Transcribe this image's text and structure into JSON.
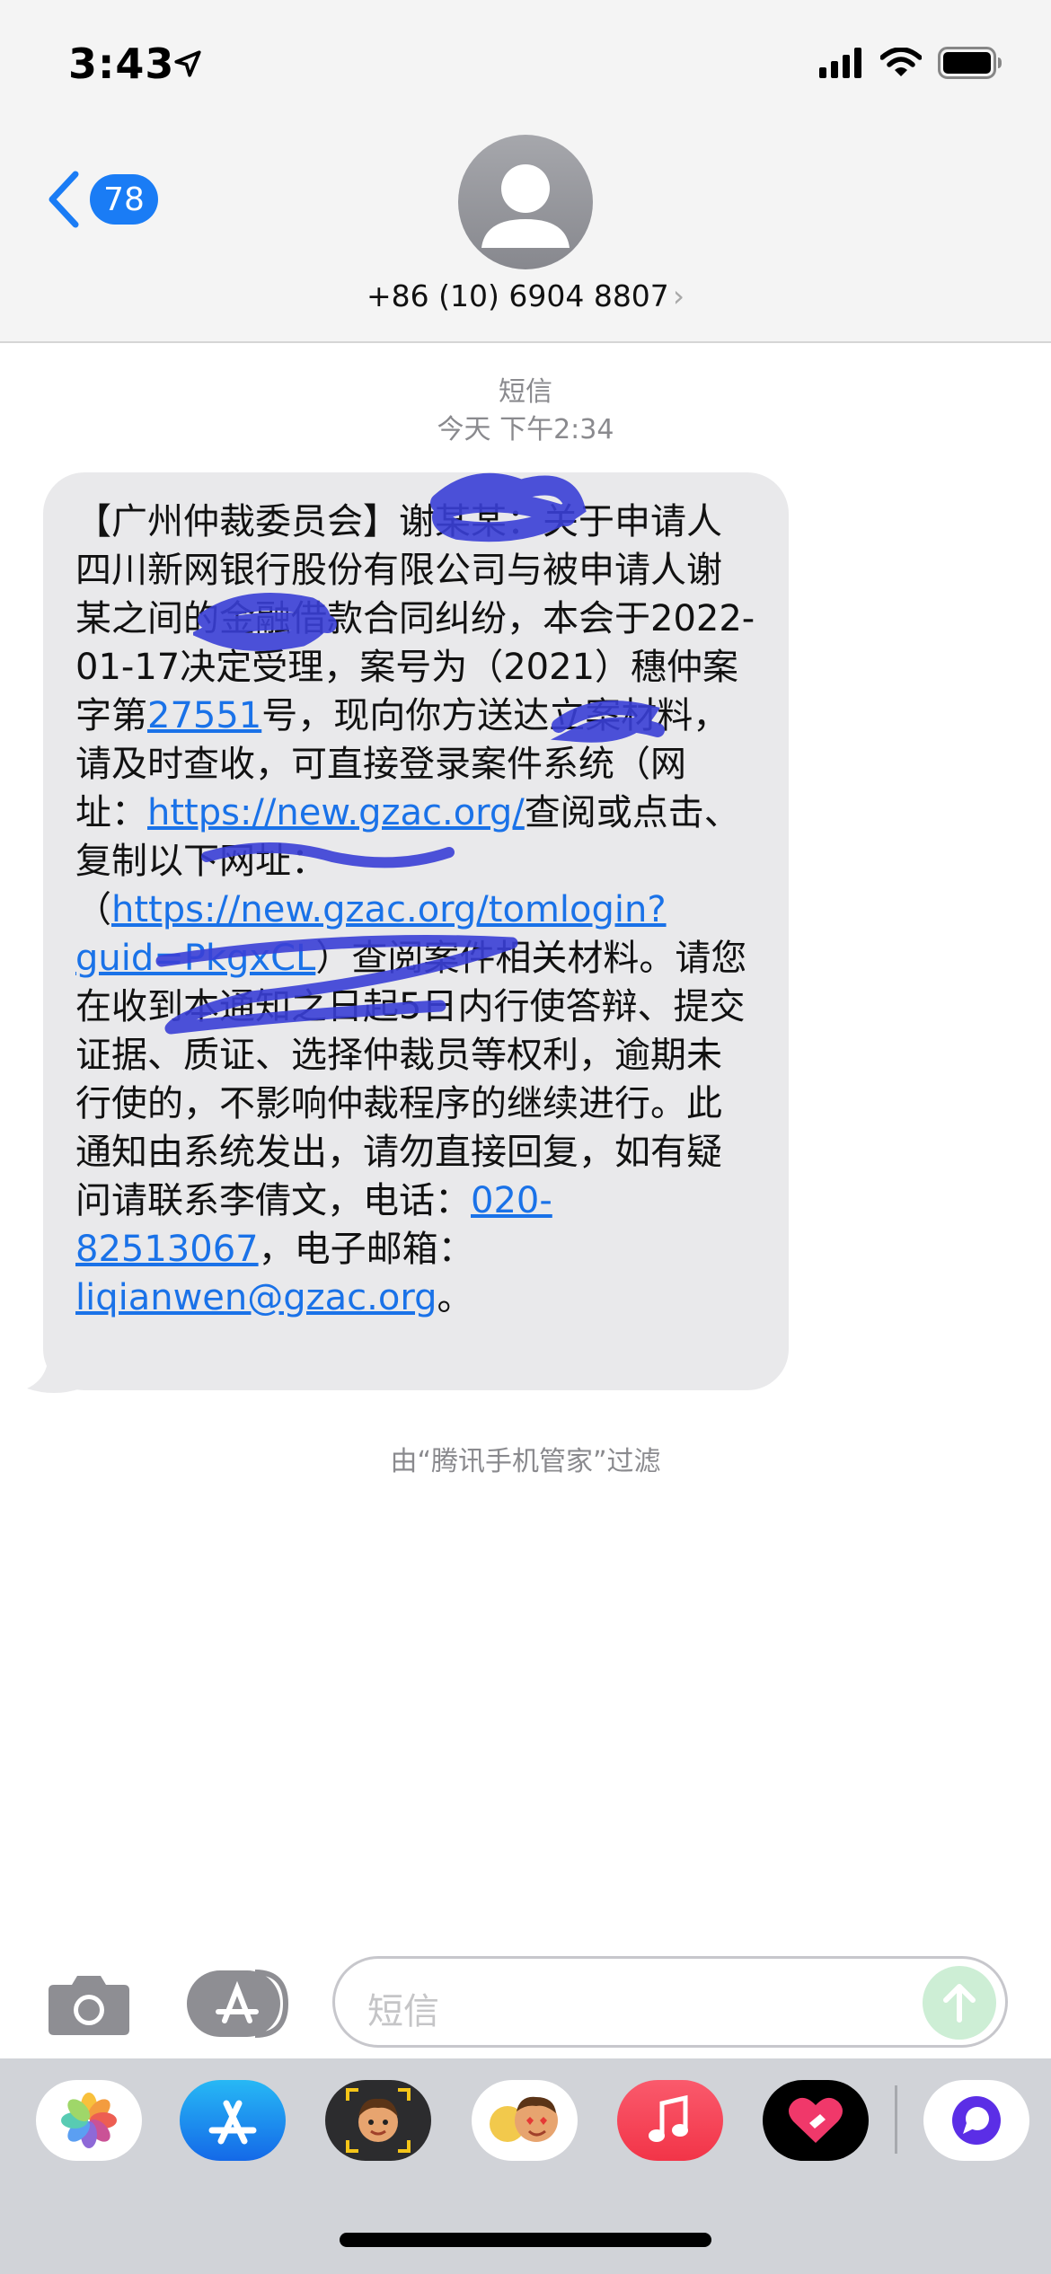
{
  "status_bar": {
    "time": "3:43"
  },
  "header": {
    "back_badge": "78",
    "contact": "+86 (10) 6904 8807",
    "contact_chevron": "›"
  },
  "message": {
    "service": "短信",
    "timestamp": "今天 下午2:34",
    "t1": "【广州仲裁委员会】",
    "t2": "：关于申请人四川新网银行股份有限公司与被申请人",
    "t3": "之间的金融借款合同纠纷，本会于2022-01-17决定受理，案号为（2021）穗仲案字第",
    "link_case": "27551",
    "t4": "号，现向你方送达立案材料，请及时查收，可直接登录案件系统（网址：",
    "link_site": "https://new.gzac.org/",
    "t5": "查阅或点击、复制以下网址：（",
    "link_login": "https://new.gzac.org/tomlogin?guid=PkgxCL",
    "t6": "）查阅案件相关材料。请您在收到本通知之日起5日内行使答辩、提交证据、质证、选择仲裁员等权利，逾期未行使的，不影响仲裁程序的继续进行。此通知由系统发出，请勿直接回复，如有疑问请联系李倩文，电话：",
    "link_phone": "020-82513067",
    "t7": "，电子邮箱：",
    "link_email": "liqianwen@gzac.org",
    "t8": "。"
  },
  "filter_note": "由“腾讯手机管家”过滤",
  "input_bar": {
    "placeholder": "短信"
  },
  "drawer": {
    "apps": [
      "photos-app",
      "app-store-app",
      "memoji-app",
      "animoji-stickers-app",
      "music-app",
      "digital-touch-app",
      "assistant-app"
    ]
  },
  "colors": {
    "accent": "#1a7cf5",
    "link": "#1a72e8",
    "bubble": "#e9e9eb",
    "scribble": "#3a3fd6"
  }
}
